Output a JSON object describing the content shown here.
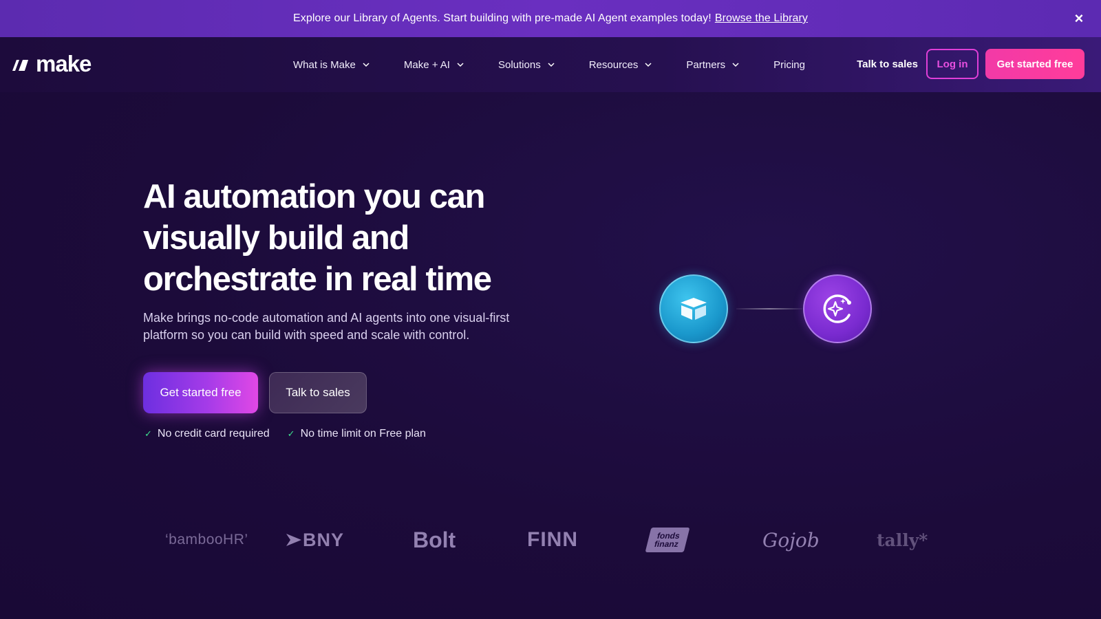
{
  "announcement": {
    "text": "Explore our Library of Agents. Start building with pre-made AI Agent examples today!",
    "link": "Browse the Library",
    "close": "×"
  },
  "nav": {
    "logo_text": "make",
    "menu": [
      {
        "label": "What is Make",
        "has_dropdown": true
      },
      {
        "label": "Make + AI",
        "has_dropdown": true
      },
      {
        "label": "Solutions",
        "has_dropdown": true
      },
      {
        "label": "Resources",
        "has_dropdown": true
      },
      {
        "label": "Partners",
        "has_dropdown": true
      },
      {
        "label": "Pricing",
        "has_dropdown": false
      }
    ],
    "talk_to_sales": "Talk to sales",
    "log_in": "Log in",
    "get_started": "Get started free"
  },
  "hero": {
    "title_line1": "AI automation you can",
    "title_line2": "visually build and",
    "title_line3": "orchestrate in real time",
    "subtitle_line1": "Make brings no-code automation and AI agents into one visual-first",
    "subtitle_line2": "platform so you can build with speed and scale with control.",
    "cta_primary": "Get started free",
    "cta_secondary": "Talk to sales",
    "checks": [
      "No credit card required",
      "No time limit on Free plan"
    ]
  },
  "illustration": {
    "node_left_icon": "airtable-box-icon",
    "node_right_icon": "ai-sparkle-loop-icon"
  },
  "logos": {
    "bamboohr": "‘bambooHR’",
    "bny": "BNY",
    "bolt": "Bolt",
    "finn": "FINN",
    "fonds_line1": "fonds",
    "fonds_line2": "finanz",
    "gojob": "Gojob",
    "tally": "tally*"
  },
  "colors": {
    "background": "#1c0b3a",
    "announcement": "#6a2fc0",
    "accent_pink": "#ff3c9a",
    "login_border": "#e03fd8",
    "check_green": "#3ee08e"
  }
}
